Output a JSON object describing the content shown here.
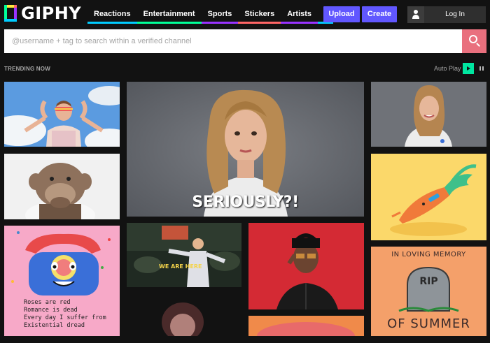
{
  "header": {
    "logo_text": "GIPHY",
    "nav": [
      {
        "label": "Reactions",
        "color": "#00ccff"
      },
      {
        "label": "Entertainment",
        "color": "#00ff99"
      },
      {
        "label": "Sports",
        "color": "#9933ff"
      },
      {
        "label": "Stickers",
        "color": "#ff6666"
      },
      {
        "label": "Artists",
        "color": "#9933ff"
      }
    ],
    "more_color": "#00ccff",
    "upload_label": "Upload",
    "create_label": "Create",
    "login_label": "Log In",
    "accent_color": "#6157ff"
  },
  "search": {
    "placeholder": "@username + tag to search within a verified channel",
    "button_color": "#e9707e"
  },
  "trending": {
    "title": "TRENDING NOW",
    "autoplay_label": "Auto Play"
  },
  "tiles": {
    "seriously_caption": "SERIOUSLY?!",
    "dance_caption": "WE ARE HERE",
    "poem_lines": [
      "Roses are red",
      "Romance is dead",
      "Every day I suffer from",
      "Existential dread"
    ],
    "memorial_top": "IN LOVING MEMORY",
    "memorial_stone": "RIP",
    "memorial_bottom": "OF SUMMER"
  }
}
